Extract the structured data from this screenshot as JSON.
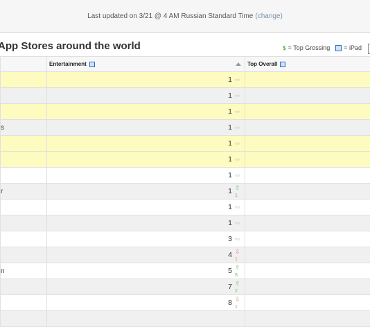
{
  "update_bar": {
    "text": "Last updated on 3/21 @ 4 AM Russian Standard Time",
    "change_link": "(change)"
  },
  "section": {
    "title": "App Stores around the world"
  },
  "legend": {
    "grossing_symbol": "$",
    "grossing_label": "= Top Grossing",
    "ipad_label": "= iPad"
  },
  "table": {
    "columns": [
      {
        "label": ""
      },
      {
        "label": "Entertainment",
        "ipad": true,
        "sorted": "ascending"
      },
      {
        "label": "Top Overall",
        "ipad": true
      }
    ],
    "rows": [
      {
        "country_fragment": "",
        "rank": "1",
        "trend": "same",
        "delta": "",
        "highlight": true
      },
      {
        "country_fragment": "",
        "rank": "1",
        "trend": "same",
        "delta": "",
        "highlight": false
      },
      {
        "country_fragment": "",
        "rank": "1",
        "trend": "same",
        "delta": "",
        "highlight": true
      },
      {
        "country_fragment": "s",
        "rank": "1",
        "trend": "same",
        "delta": "",
        "highlight": false
      },
      {
        "country_fragment": "",
        "rank": "1",
        "trend": "same",
        "delta": "",
        "highlight": true
      },
      {
        "country_fragment": "",
        "rank": "1",
        "trend": "same",
        "delta": "",
        "highlight": true
      },
      {
        "country_fragment": "",
        "rank": "1",
        "trend": "same",
        "delta": "",
        "highlight": false
      },
      {
        "country_fragment": "r",
        "rank": "1",
        "trend": "up",
        "delta": "1",
        "highlight": false
      },
      {
        "country_fragment": "",
        "rank": "1",
        "trend": "same",
        "delta": "",
        "highlight": false
      },
      {
        "country_fragment": "",
        "rank": "1",
        "trend": "same",
        "delta": "",
        "highlight": false
      },
      {
        "country_fragment": "",
        "rank": "3",
        "trend": "same",
        "delta": "",
        "highlight": false
      },
      {
        "country_fragment": "",
        "rank": "4",
        "trend": "down",
        "delta": "1",
        "highlight": false
      },
      {
        "country_fragment": "n",
        "rank": "5",
        "trend": "up",
        "delta": "8",
        "highlight": false
      },
      {
        "country_fragment": "",
        "rank": "7",
        "trend": "up",
        "delta": "2",
        "highlight": false
      },
      {
        "country_fragment": "",
        "rank": "8",
        "trend": "down",
        "delta": "1",
        "highlight": false
      },
      {
        "country_fragment": "",
        "rank": "",
        "trend": "",
        "delta": "",
        "highlight": false
      }
    ]
  },
  "colors": {
    "highlight_row": "#fdfbbf",
    "alt_row": "#f0f0f0",
    "trend_up": "#6fc36f",
    "trend_down": "#e58a8a",
    "trend_same": "#c9c9c9",
    "link": "#7a8fa6"
  }
}
